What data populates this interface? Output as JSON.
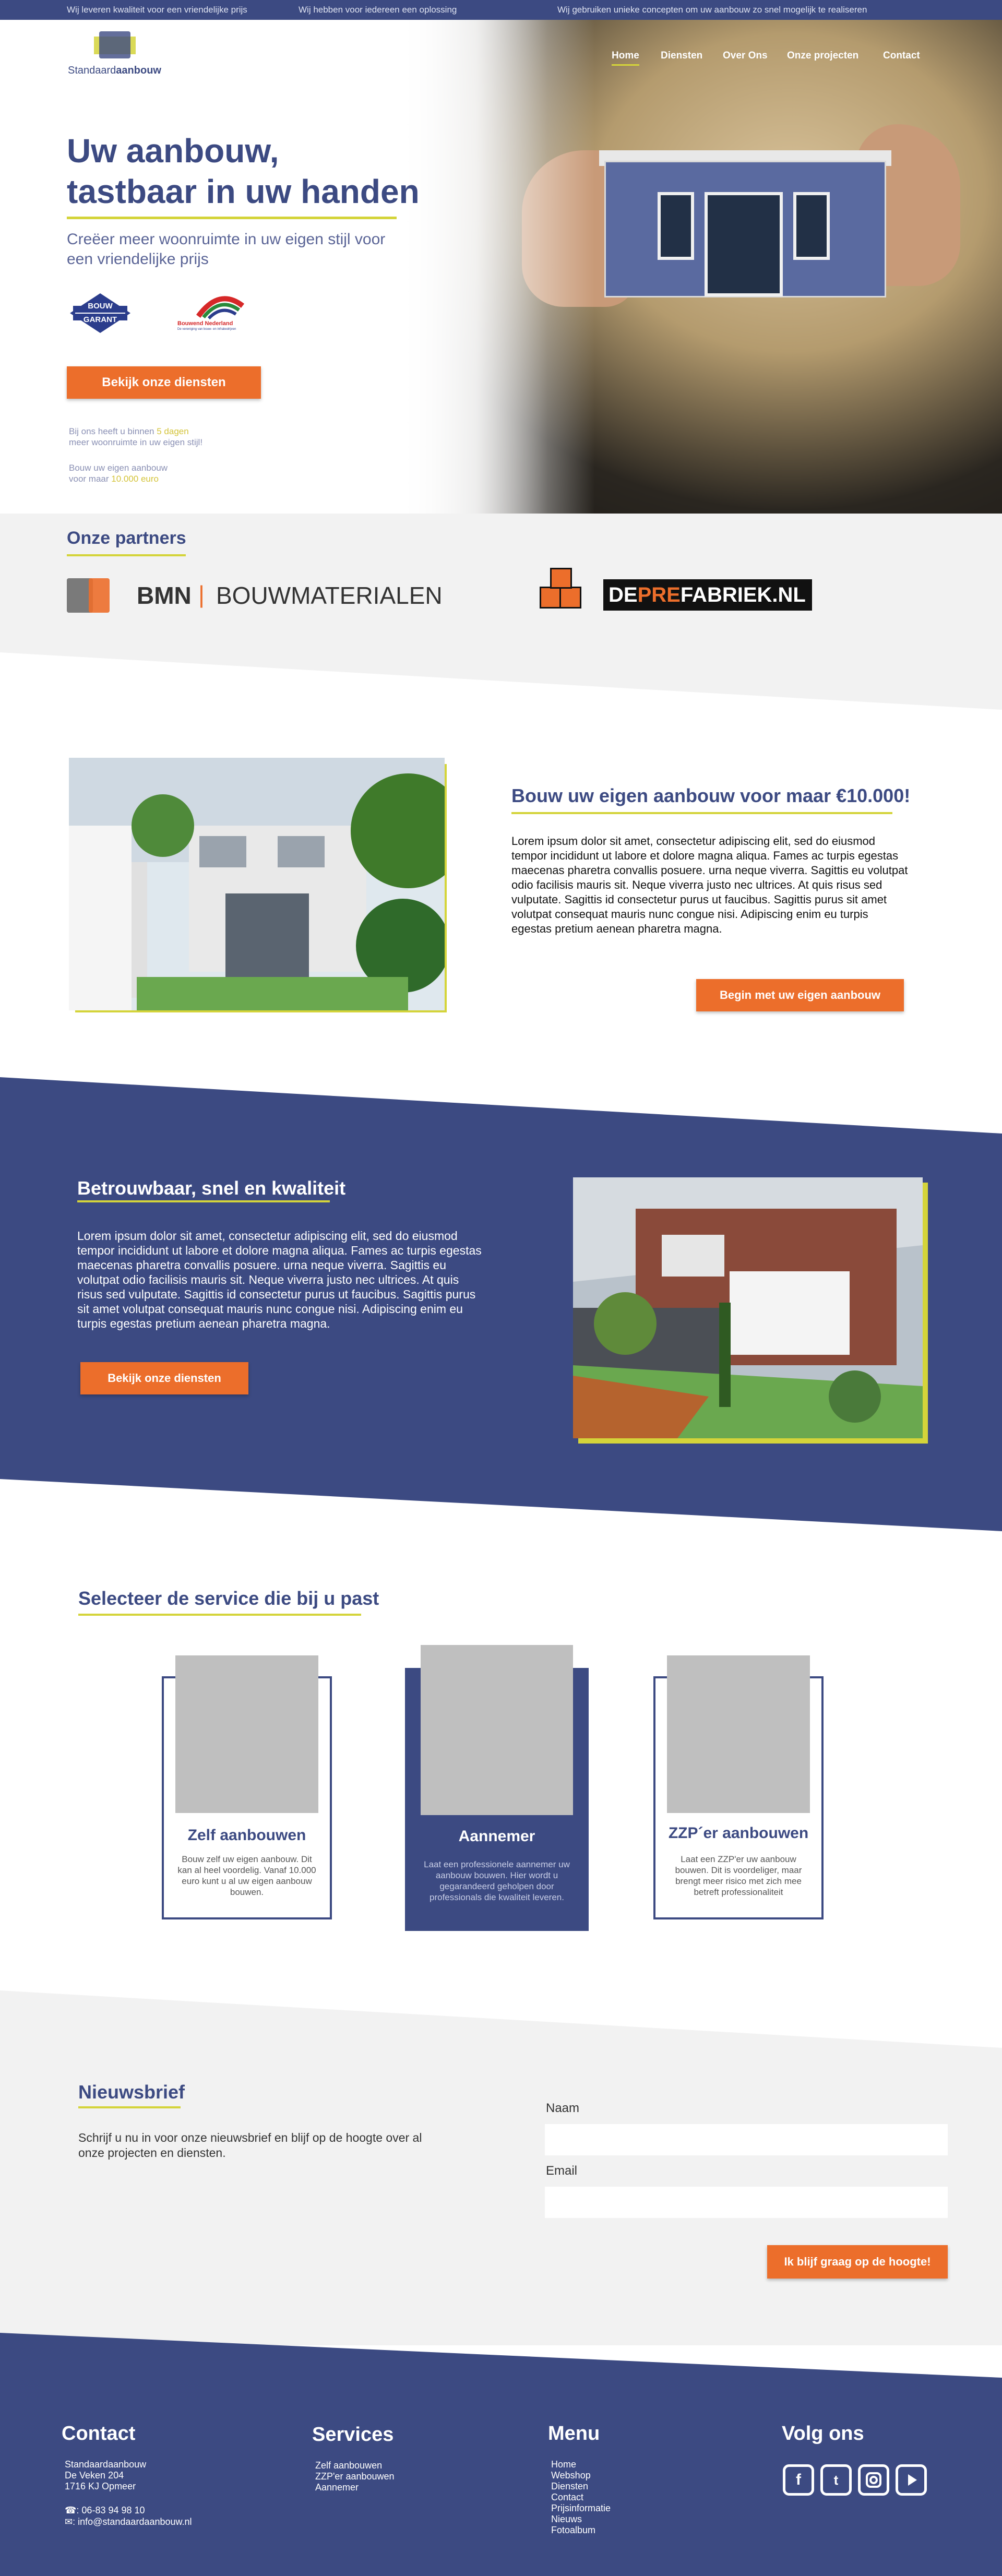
{
  "topbar": {
    "item1": "Wij leveren kwaliteit voor een vriendelijke prijs",
    "item2": "Wij hebben voor iedereen een oplossing",
    "item3": "Wij gebruiken unieke concepten om uw aanbouw zo snel mogelijk te realiseren"
  },
  "logo": {
    "part1": "Standaard",
    "part2": "aanbouw"
  },
  "nav": {
    "home": "Home",
    "diensten": "Diensten",
    "over_ons": "Over Ons",
    "projecten": "Onze projecten",
    "contact": "Contact"
  },
  "hero": {
    "title_line1": "Uw aanbouw,",
    "title_line2": "tastbaar in uw handen",
    "subtitle": "Creëer meer woonruimte in uw eigen stijl voor een vriendelijke prijs",
    "badge1_line1": "BOUW",
    "badge1_line2": "GARANT",
    "badge2_line1": "Bouwend Nederland",
    "badge2_line2": "De vereniging van bouw- en infrabedrijven",
    "button": "Bekijk onze diensten",
    "note1_pre": "Bij ons heeft u binnen ",
    "note1_hl": "5 dagen",
    "note1_post": "meer woonruimte in uw eigen stijl!",
    "note2_line1": "Bouw uw eigen aanbouw",
    "note2_pre": "voor maar ",
    "note2_hl": "10.000 euro"
  },
  "partners": {
    "title": "Onze partners",
    "partner1_name": "BMN",
    "partner1_sep": "|",
    "partner1_sub": "BOUWMATERIALEN",
    "partner2_name_de": "DE",
    "partner2_name_pre": "PRE",
    "partner2_name_rest": "FABRIEK.NL"
  },
  "section1": {
    "title": "Bouw uw eigen aanbouw voor maar €10.000!",
    "text": "Lorem ipsum dolor sit amet, consectetur adipiscing elit, sed do eiusmod tempor incididunt ut labore et dolore magna aliqua. Fames ac turpis egestas maecenas pharetra convallis posuere. urna neque viverra. Sagittis eu volutpat odio facilisis mauris sit. Neque viverra justo nec ultrices. At quis risus sed vulputate. Sagittis id consectetur purus ut faucibus. Sagittis purus sit amet volutpat consequat mauris nunc congue nisi. Adipiscing enim eu turpis egestas pretium aenean pharetra magna.",
    "button": "Begin met uw eigen aanbouw"
  },
  "section2": {
    "title": "Betrouwbaar, snel en kwaliteit",
    "text": "Lorem ipsum dolor sit amet, consectetur adipiscing elit, sed do eiusmod tempor incididunt ut labore et dolore magna aliqua. Fames ac turpis egestas maecenas pharetra convallis posuere. urna neque viverra. Sagittis eu volutpat odio facilisis mauris sit. Neque viverra justo nec ultrices. At quis risus sed vulputate. Sagittis id consectetur purus ut faucibus. Sagittis purus sit amet volutpat consequat mauris nunc congue nisi. Adipiscing enim eu turpis egestas pretium aenean pharetra magna.",
    "button": "Bekijk onze diensten"
  },
  "services": {
    "title": "Selecteer de service die bij u past",
    "cards": [
      {
        "title": "Zelf aanbouwen",
        "text": "Bouw zelf uw eigen aanbouw. Dit kan al heel voordelig. Vanaf 10.000 euro kunt u al uw eigen aanbouw bouwen."
      },
      {
        "title": "Aannemer",
        "text": "Laat een professionele aannemer uw aanbouw bouwen. Hier wordt u gegarandeerd geholpen door professionals die kwaliteit leveren."
      },
      {
        "title": "ZZP´er aanbouwen",
        "text": "Laat een ZZP'er uw aanbouw bouwen. Dit is voordeliger, maar brengt meer risico met zich mee betreft professionaliteit"
      }
    ]
  },
  "newsletter": {
    "title": "Nieuwsbrief",
    "text": "Schrijf u nu in voor onze nieuwsbrief en blijf op de hoogte over al onze projecten en diensten.",
    "name_label": "Naam",
    "email_label": "Email",
    "button": "Ik blijf graag op de hoogte!"
  },
  "footer": {
    "contact_title": "Contact",
    "contact_name": "Standaardaanbouw",
    "contact_street": "De Veken 204",
    "contact_city": "1716 KJ Opmeer",
    "contact_phone": ": 06-83 94 98 10",
    "contact_email": ": info@standaardaanbouw.nl",
    "services_title": "Services",
    "services": [
      "Zelf aanbouwen",
      "ZZP'er aanbouwen",
      "Aannemer"
    ],
    "menu_title": "Menu",
    "menu": [
      "Home",
      "Webshop",
      "Diensten",
      "Contact",
      "Prijsinformatie",
      "Nieuws",
      "Fotoalbum"
    ],
    "social_title": "Volg ons",
    "social_icons": [
      "facebook-icon",
      "twitter-icon",
      "instagram-icon",
      "youtube-icon"
    ]
  },
  "colors": {
    "brand_blue": "#3c4a82",
    "accent_yellow": "#d4d43a",
    "accent_orange": "#ec6e2b",
    "light_gray": "#f2f2f2"
  }
}
